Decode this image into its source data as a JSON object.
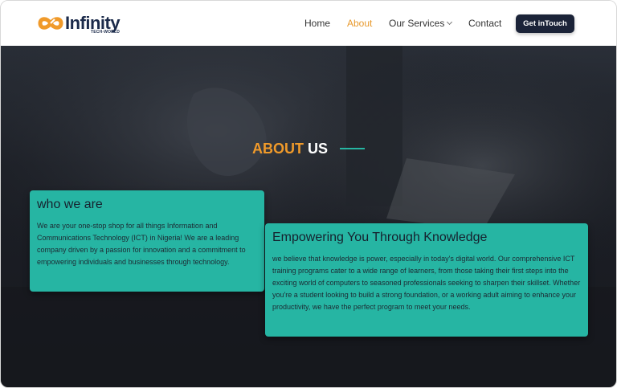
{
  "brand": {
    "name": "Infinity",
    "tagline": "TECH-WORLD",
    "logo_icon": "infinity-logo-icon",
    "colors": {
      "orange": "#f09a2a",
      "navy": "#1b2a4a",
      "teal": "#26b5a3"
    }
  },
  "nav": {
    "items": [
      {
        "label": "Home"
      },
      {
        "label": "About",
        "active": true
      },
      {
        "label": "Our Services",
        "has_dropdown": true
      },
      {
        "label": "Contact"
      }
    ],
    "cta_label": "Get inTouch"
  },
  "hero": {
    "title_accent": "ABOUT",
    "title_rest": "US"
  },
  "cards": [
    {
      "heading": "who we are",
      "body": "We are your one-stop shop for all things Information and Communications Technology (ICT) in Nigeria! We are a leading company driven by a passion for innovation and a commitment to empowering individuals and businesses through technology."
    },
    {
      "heading": "Empowering You Through Knowledge",
      "body": "we believe that knowledge is power, especially in today's digital world. Our comprehensive ICT training programs cater to a wide range of learners, from those taking their first steps into the exciting world of computers to seasoned professionals seeking to sharpen their skillset. Whether you're a student looking to build a strong foundation, or a working adult aiming to enhance your productivity, we have the perfect program to meet your needs."
    }
  ]
}
